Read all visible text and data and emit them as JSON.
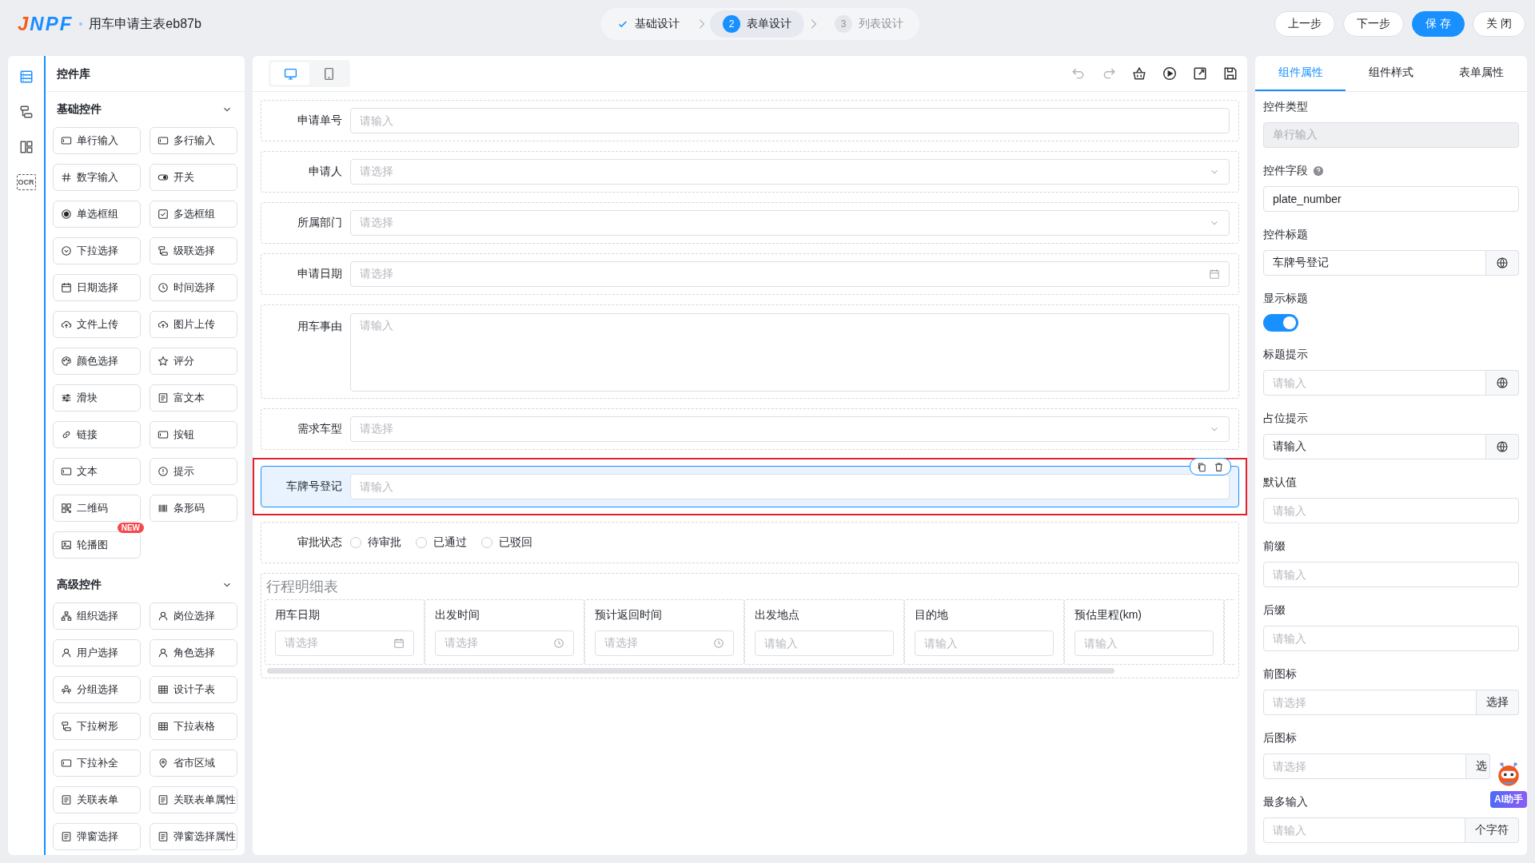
{
  "header": {
    "logo": "JNPF",
    "title": "用车申请主表eb87b",
    "steps": [
      {
        "label": "基础设计",
        "done": true,
        "selected": false
      },
      {
        "index": "2",
        "label": "表单设计",
        "done": false,
        "selected": true
      },
      {
        "index": "3",
        "label": "列表设计",
        "done": false,
        "selected": false
      }
    ],
    "buttons": [
      {
        "label": "上一步",
        "kind": "default"
      },
      {
        "label": "下一步",
        "kind": "default"
      },
      {
        "label": "保 存",
        "kind": "primary"
      },
      {
        "label": "关 闭",
        "kind": "default"
      }
    ]
  },
  "rail": [
    {
      "kind": "list",
      "selected": true
    },
    {
      "kind": "tree",
      "selected": false
    },
    {
      "kind": "layout",
      "selected": false
    },
    {
      "kind": "ocr",
      "text": "OCR",
      "selected": false
    }
  ],
  "library": {
    "title": "控件库",
    "groups": [
      {
        "title": "基础控件",
        "expanded": true,
        "items": [
          {
            "label": "单行输入",
            "kind": "field"
          },
          {
            "label": "多行输入",
            "kind": "field"
          },
          {
            "label": "数字输入",
            "kind": "hash"
          },
          {
            "label": "开关",
            "kind": "toggle"
          },
          {
            "label": "单选框组",
            "kind": "radio"
          },
          {
            "label": "多选框组",
            "kind": "checkbox"
          },
          {
            "label": "下拉选择",
            "kind": "chevron-circle"
          },
          {
            "label": "级联选择",
            "kind": "tree"
          },
          {
            "label": "日期选择",
            "kind": "calendar"
          },
          {
            "label": "时间选择",
            "kind": "clock"
          },
          {
            "label": "文件上传",
            "kind": "cloud-upload"
          },
          {
            "label": "图片上传",
            "kind": "cloud-upload"
          },
          {
            "label": "颜色选择",
            "kind": "palette"
          },
          {
            "label": "评分",
            "kind": "star"
          },
          {
            "label": "滑块",
            "kind": "sliders"
          },
          {
            "label": "富文本",
            "kind": "document"
          },
          {
            "label": "链接",
            "kind": "link"
          },
          {
            "label": "按钮",
            "kind": "field"
          },
          {
            "label": "文本",
            "kind": "field"
          },
          {
            "label": "提示",
            "kind": "alert"
          },
          {
            "label": "二维码",
            "kind": "qr"
          },
          {
            "label": "条形码",
            "kind": "barcode"
          },
          {
            "label": "轮播图",
            "kind": "image",
            "badge": "NEW"
          }
        ]
      },
      {
        "title": "高级控件",
        "expanded": true,
        "items": [
          {
            "label": "组织选择",
            "kind": "org"
          },
          {
            "label": "岗位选择",
            "kind": "user"
          },
          {
            "label": "用户选择",
            "kind": "user"
          },
          {
            "label": "角色选择",
            "kind": "user"
          },
          {
            "label": "分组选择",
            "kind": "users"
          },
          {
            "label": "设计子表",
            "kind": "table"
          },
          {
            "label": "下拉树形",
            "kind": "tree"
          },
          {
            "label": "下拉表格",
            "kind": "table"
          },
          {
            "label": "下拉补全",
            "kind": "field"
          },
          {
            "label": "省市区域",
            "kind": "map-pin"
          },
          {
            "label": "关联表单",
            "kind": "document"
          },
          {
            "label": "关联表单属性",
            "kind": "document"
          },
          {
            "label": "弹窗选择",
            "kind": "document"
          },
          {
            "label": "弹窗选择属性",
            "kind": "document"
          }
        ]
      }
    ]
  },
  "toolbar": {
    "devices": [
      {
        "kind": "monitor",
        "selected": true
      },
      {
        "kind": "tablet",
        "selected": false
      }
    ],
    "tools": [
      {
        "kind": "undo",
        "disabled": true
      },
      {
        "kind": "redo",
        "disabled": true
      },
      {
        "kind": "basket",
        "disabled": false
      },
      {
        "kind": "play",
        "disabled": false
      },
      {
        "kind": "export",
        "disabled": false
      },
      {
        "kind": "save",
        "disabled": false
      }
    ]
  },
  "form": [
    {
      "label": "申请单号",
      "kind": "input",
      "placeholder": "请输入",
      "selected": false
    },
    {
      "label": "申请人",
      "kind": "select",
      "placeholder": "请选择",
      "selected": false
    },
    {
      "label": "所属部门",
      "kind": "select",
      "placeholder": "请选择",
      "selected": false
    },
    {
      "label": "申请日期",
      "kind": "date",
      "placeholder": "请选择",
      "selected": false
    },
    {
      "label": "用车事由",
      "kind": "textarea",
      "placeholder": "请输入",
      "selected": false
    },
    {
      "label": "需求车型",
      "kind": "select",
      "placeholder": "请选择",
      "selected": false
    },
    {
      "label": "车牌号登记",
      "kind": "input",
      "placeholder": "请输入",
      "selected": true
    },
    {
      "label": "审批状态",
      "kind": "radio",
      "options": [
        {
          "label": "待审批",
          "selected": false
        },
        {
          "label": "已通过",
          "selected": false
        },
        {
          "label": "已驳回",
          "selected": false
        }
      ],
      "selected": false
    },
    {
      "title": "行程明细表",
      "kind": "table",
      "selected": false,
      "columns": [
        {
          "label": "用车日期",
          "kind": "date",
          "placeholder": "请选择"
        },
        {
          "label": "出发时间",
          "kind": "time",
          "placeholder": "请选择"
        },
        {
          "label": "预计返回时间",
          "kind": "time",
          "placeholder": "请选择"
        },
        {
          "label": "出发地点",
          "kind": "input",
          "placeholder": "请输入"
        },
        {
          "label": "目的地",
          "kind": "input",
          "placeholder": "请输入"
        },
        {
          "label": "预估里程(km)",
          "kind": "input",
          "placeholder": "请输入"
        }
      ]
    }
  ],
  "panel": {
    "tabs": [
      {
        "label": "组件属性",
        "selected": true
      },
      {
        "label": "组件样式",
        "selected": false
      },
      {
        "label": "表单属性",
        "selected": false
      }
    ],
    "props": [
      {
        "label": "控件类型",
        "kind": "input",
        "value": "单行输入",
        "disabled": true,
        "help": false
      },
      {
        "label": "控件字段",
        "kind": "input",
        "value": "plate_number",
        "disabled": false,
        "help": true
      },
      {
        "label": "控件标题",
        "kind": "globe",
        "value": "车牌号登记",
        "disabled": false,
        "help": false
      },
      {
        "label": "显示标题",
        "kind": "switch",
        "on": true,
        "disabled": false,
        "help": false
      },
      {
        "label": "标题提示",
        "kind": "globe",
        "placeholder": "请输入",
        "disabled": false,
        "help": false
      },
      {
        "label": "占位提示",
        "kind": "globe",
        "value": "请输入",
        "disabled": false,
        "help": false
      },
      {
        "label": "默认值",
        "kind": "input",
        "placeholder": "请输入",
        "disabled": false,
        "help": false
      },
      {
        "label": "前缀",
        "kind": "input",
        "placeholder": "请输入",
        "disabled": false,
        "help": false
      },
      {
        "label": "后缀",
        "kind": "input",
        "placeholder": "请输入",
        "disabled": false,
        "help": false
      },
      {
        "label": "前图标",
        "kind": "addon",
        "placeholder": "请选择",
        "addon": "选择",
        "disabled": false,
        "help": false
      },
      {
        "label": "后图标",
        "kind": "addon",
        "placeholder": "请选择",
        "addon": "选",
        "disabled": false,
        "help": false
      },
      {
        "label": "最多输入",
        "kind": "addon",
        "placeholder": "请输入",
        "addon": "个字符",
        "disabled": false,
        "help": false
      }
    ]
  },
  "assistant": {
    "label": "AI助手"
  }
}
